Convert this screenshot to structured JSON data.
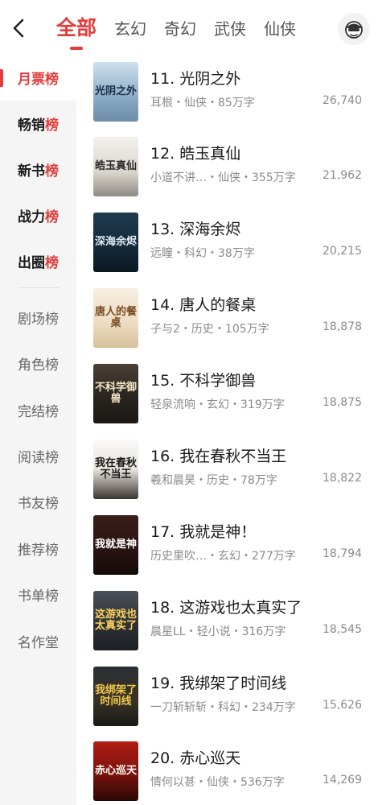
{
  "header": {
    "tabs": [
      {
        "label": "全部"
      },
      {
        "label": "玄幻"
      },
      {
        "label": "奇幻"
      },
      {
        "label": "武侠"
      },
      {
        "label": "仙侠"
      }
    ]
  },
  "sidebar": {
    "items": [
      {
        "label": "月票榜"
      },
      {
        "label": "畅销榜"
      },
      {
        "label": "新书榜"
      },
      {
        "label": "战力榜"
      },
      {
        "label": "出圈榜"
      },
      {
        "label": "剧场榜"
      },
      {
        "label": "角色榜"
      },
      {
        "label": "完结榜"
      },
      {
        "label": "阅读榜"
      },
      {
        "label": "书友榜"
      },
      {
        "label": "推荐榜"
      },
      {
        "label": "书单榜"
      },
      {
        "label": "名作堂"
      }
    ]
  },
  "books": [
    {
      "title": "11. 光阴之外",
      "meta": "耳根・仙侠・85万字",
      "votes": "26,740",
      "cover_text": "光阴之外"
    },
    {
      "title": "12. 皓玉真仙",
      "meta": "小道不讲…・仙侠・355万字",
      "votes": "21,962",
      "cover_text": "皓玉真仙"
    },
    {
      "title": "13. 深海余烬",
      "meta": "远瞳・科幻・38万字",
      "votes": "20,215",
      "cover_text": "深海余烬"
    },
    {
      "title": "14. 唐人的餐桌",
      "meta": "子与2・历史・105万字",
      "votes": "18,878",
      "cover_text": "唐人的餐桌"
    },
    {
      "title": "15. 不科学御兽",
      "meta": "轻泉流响・玄幻・319万字",
      "votes": "18,875",
      "cover_text": "不科学御兽"
    },
    {
      "title": "16. 我在春秋不当王",
      "meta": "羲和晨昊・历史・78万字",
      "votes": "18,822",
      "cover_text": "我在春秋不当王"
    },
    {
      "title": "17. 我就是神！",
      "meta": "历史里吹…・玄幻・277万字",
      "votes": "18,794",
      "cover_text": "我就是神"
    },
    {
      "title": "18. 这游戏也太真实了",
      "meta": "晨星LL・轻小说・316万字",
      "votes": "18,545",
      "cover_text": "这游戏也太真实了"
    },
    {
      "title": "19. 我绑架了时间线",
      "meta": "一刀斩斩斩・科幻・234万字",
      "votes": "15,626",
      "cover_text": "我绑架了时间线"
    },
    {
      "title": "20. 赤心巡天",
      "meta": "情何以甚・仙侠・536万字",
      "votes": "14,269",
      "cover_text": "赤心巡天"
    }
  ],
  "colors": {
    "accent": "#e53b3b",
    "sidebar_bg": "#f5f5f5",
    "meta_text": "#8a8a8a"
  }
}
